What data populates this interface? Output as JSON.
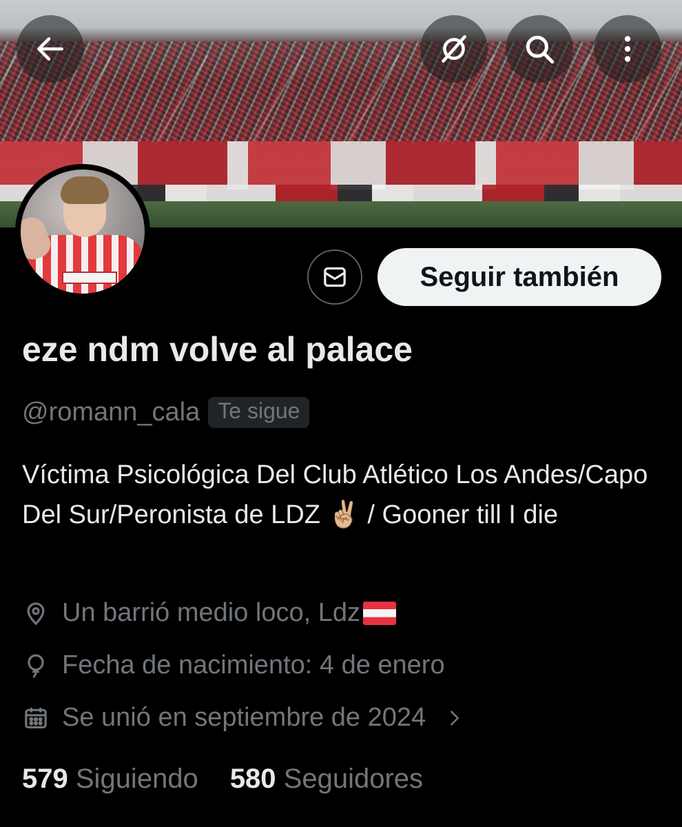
{
  "header": {
    "back_icon": "arrow-left-icon",
    "grok_icon": "grok-icon",
    "search_icon": "search-icon",
    "more_icon": "more-vertical-icon"
  },
  "actions": {
    "message_icon": "envelope-icon",
    "follow_label": "Seguir también"
  },
  "profile": {
    "display_name": "eze ndm volve al palace",
    "handle": "@romann_cala",
    "follows_you_label": "Te sigue",
    "bio": "Víctima Psicológica Del Club Atlético Los Andes/Capo Del Sur/Peronista de LDZ ✌🏼 / Gooner till I die",
    "location": "Un barrió medio loco, Ldz",
    "birthday": "Fecha de nacimiento: 4 de enero",
    "joined": "Se unió en septiembre de 2024"
  },
  "stats": {
    "following_count": "579",
    "following_label": "Siguiendo",
    "followers_count": "580",
    "followers_label": "Seguidores"
  },
  "colors": {
    "background": "#000000",
    "text_primary": "#e7e9ea",
    "text_secondary": "#71767b",
    "follow_button_bg": "#eff3f4",
    "border": "#536471"
  }
}
